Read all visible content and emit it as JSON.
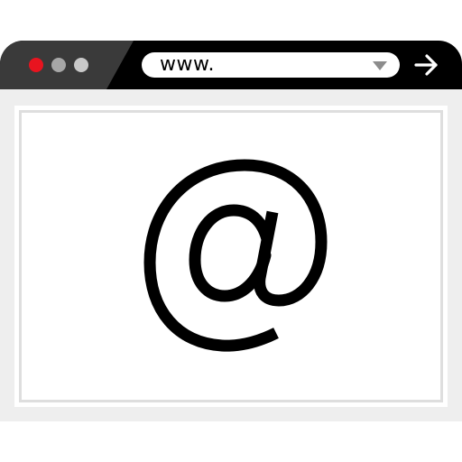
{
  "window": {
    "controls": [
      {
        "name": "close",
        "color": "#e8141f"
      },
      {
        "name": "minimize",
        "color": "#a7a7a7"
      },
      {
        "name": "maximize",
        "color": "#c9c9c9"
      }
    ]
  },
  "address_bar": {
    "value": "www."
  },
  "content": {
    "icon": "at-sign-icon"
  },
  "colors": {
    "titlebar": "#000000",
    "titlebar_accent": "#3a3a3a",
    "viewport_bg": "#eeeeee",
    "content_border": "#dedede"
  }
}
